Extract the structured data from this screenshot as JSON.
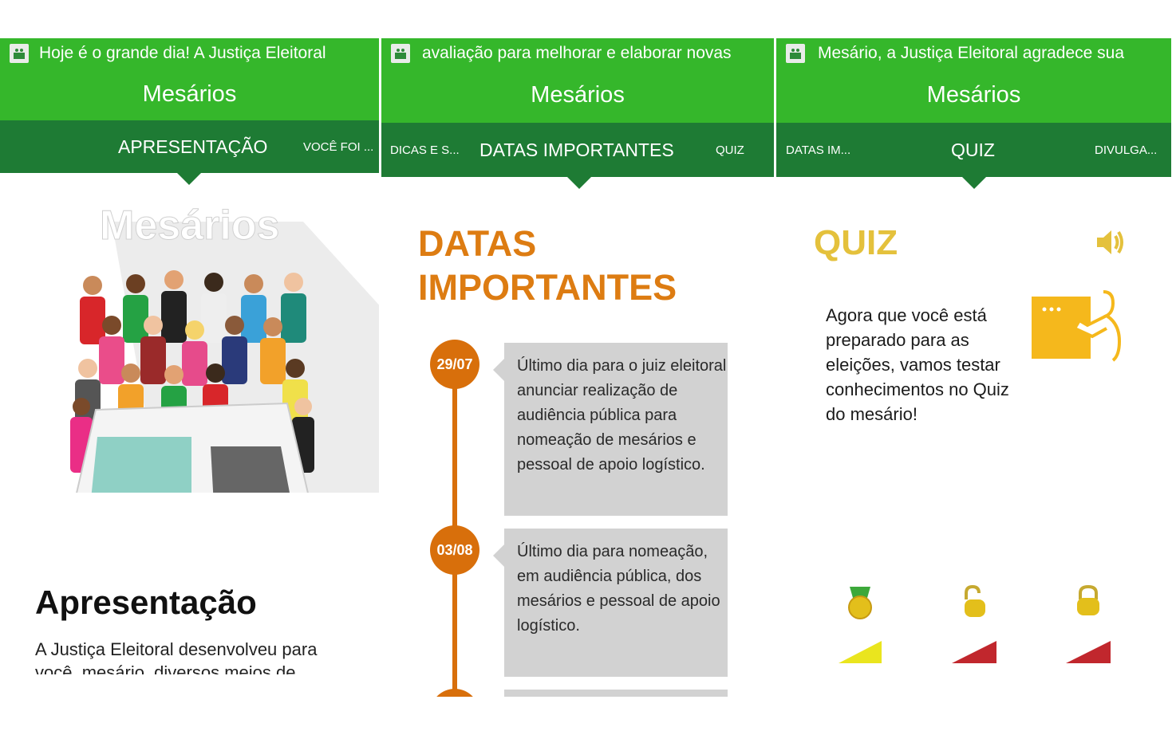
{
  "screens": [
    {
      "notification": "Hoje é o grande dia! A Justiça Eleitoral",
      "app_title": "Mesários",
      "tabs": {
        "active": "APRESENTAÇÃO",
        "right": "VOCÊ FOI ..."
      },
      "illustration_logo": "Mesários",
      "heading": "Apresentação",
      "body": "A Justiça Eleitoral desenvolveu para você, mesário, diversos meios de"
    },
    {
      "notification": "avaliação para melhorar e elaborar novas",
      "app_title": "Mesários",
      "tabs": {
        "left": "DICAS E S...",
        "active": "DATAS IMPORTANTES",
        "right": "QUIZ"
      },
      "section_title": "DATAS IMPORTANTES",
      "events": [
        {
          "date": "29/07",
          "text": "Último dia para o juiz eleitoral anunciar realização de audiência pública para nomeação de mesários e pessoal de apoio logístico."
        },
        {
          "date": "03/08",
          "text": "Último dia para nomeação, em audiência pública, dos mesários e pessoal de apoio logístico."
        }
      ]
    },
    {
      "notification": "Mesário, a Justiça Eleitoral agradece sua",
      "app_title": "Mesários",
      "tabs": {
        "left": "DATAS IM...",
        "active": "QUIZ",
        "right": "DIVULGA..."
      },
      "section_title": "QUIZ",
      "intro": "Agora que você está preparado para as eleições, vamos testar conhecimentos no Quiz do mesário!",
      "levels": [
        {
          "icon": "medal-icon",
          "status": "completed",
          "color": "#e9e11f"
        },
        {
          "icon": "unlocked-padlock-icon",
          "status": "unlocked",
          "color": "#c1272d"
        },
        {
          "icon": "locked-padlock-icon",
          "status": "locked",
          "color": "#c1272d"
        }
      ]
    }
  ],
  "colors": {
    "green": "#35b72b",
    "dark_green": "#1e7b34",
    "orange": "#d86f0b",
    "gold": "#e4c13c",
    "box_gray": "#d2d2d2"
  }
}
